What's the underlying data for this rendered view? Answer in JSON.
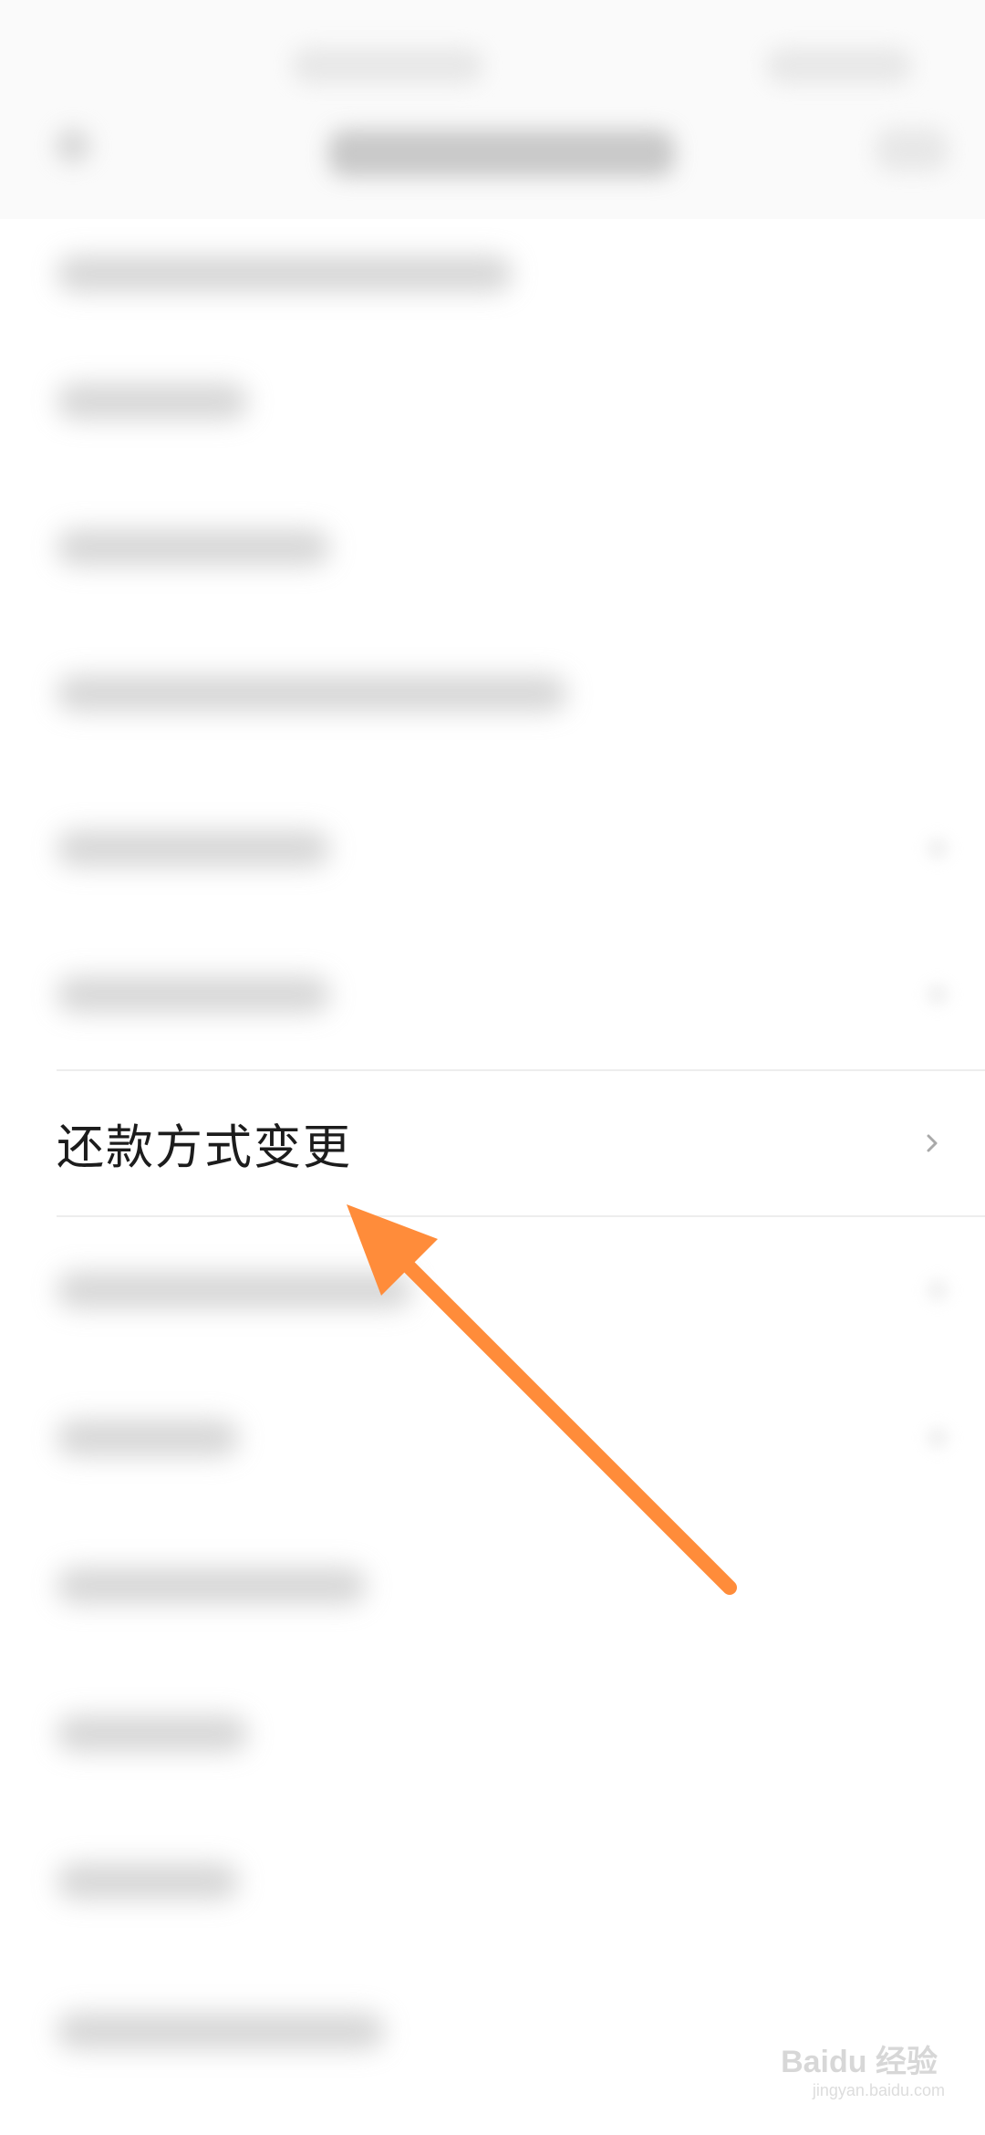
{
  "list": {
    "highlighted_item": {
      "label": "还款方式变更",
      "chevron_icon": "chevron-right-icon"
    }
  },
  "annotation": {
    "arrow_color": "#ff8c3a",
    "arrow_icon": "arrow-annotation-icon"
  },
  "watermark": {
    "brand": "Baidu 经验",
    "url": "jingyan.baidu.com"
  }
}
